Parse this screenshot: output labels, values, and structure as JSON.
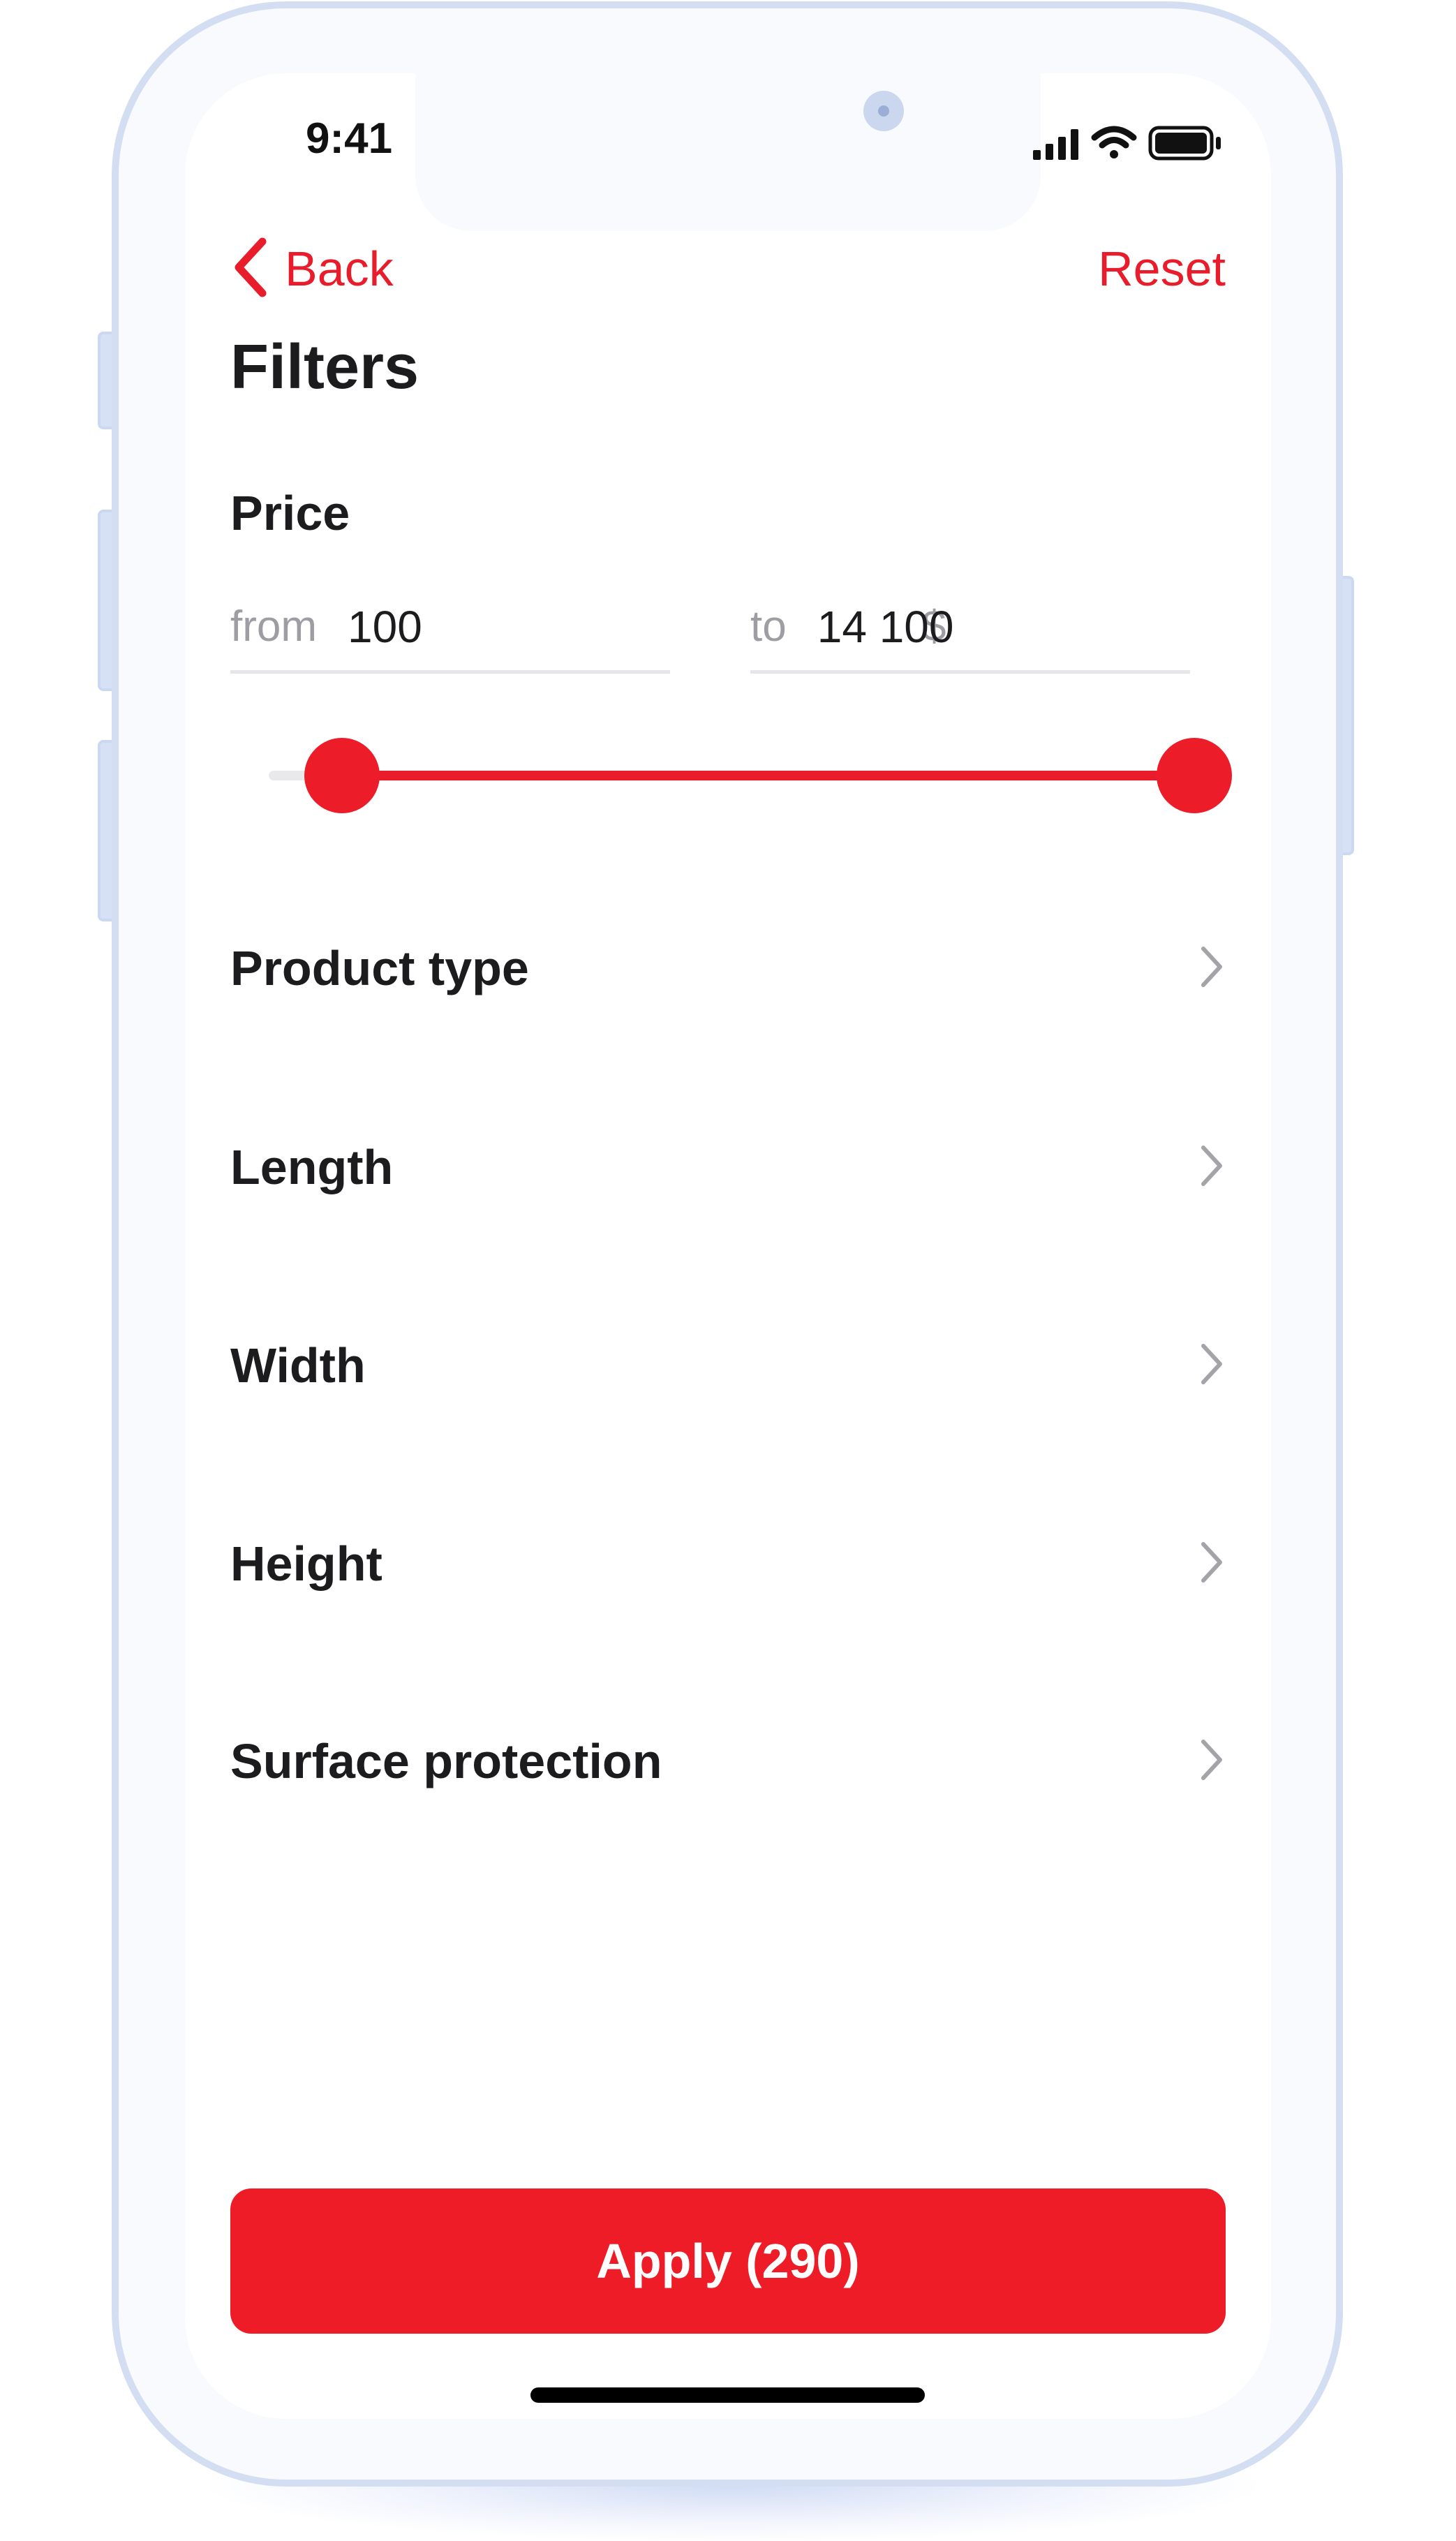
{
  "status_bar": {
    "time": "9:41",
    "icons": [
      "cellular-signal-icon",
      "wifi-icon",
      "battery-icon"
    ]
  },
  "nav": {
    "back_label": "Back",
    "reset_label": "Reset",
    "back_icon": "chevron-left-icon"
  },
  "page": {
    "title": "Filters"
  },
  "price": {
    "label": "Price",
    "from": {
      "prefix": "from",
      "value": "100",
      "unit": "$"
    },
    "to": {
      "prefix": "to",
      "value": "14 100",
      "unit": "$"
    },
    "slider": {
      "low_fraction": 0.04,
      "high_fraction": 1.0
    }
  },
  "filters": [
    {
      "label": "Product type",
      "icon": "chevron-right-icon"
    },
    {
      "label": "Length",
      "icon": "chevron-right-icon"
    },
    {
      "label": "Width",
      "icon": "chevron-right-icon"
    },
    {
      "label": "Height",
      "icon": "chevron-right-icon"
    },
    {
      "label": "Surface protection",
      "icon": "chevron-right-icon"
    }
  ],
  "apply_button": {
    "label": "Apply (290)"
  },
  "colors": {
    "accent": "#e81c2a",
    "device_frame": "#d3def3",
    "text_primary": "#1c1c1e",
    "text_secondary": "#9d9da3"
  }
}
